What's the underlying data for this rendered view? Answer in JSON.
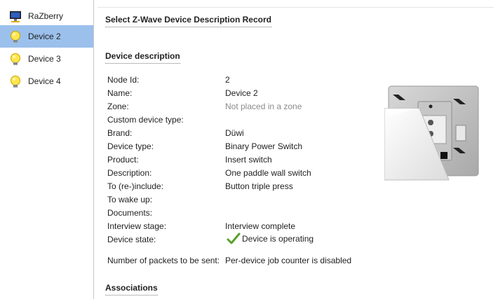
{
  "sidebar": {
    "items": [
      {
        "label": "RaZberry",
        "icon": "computer-icon",
        "active": false
      },
      {
        "label": "Device 2",
        "icon": "lightbulb-icon",
        "active": true
      },
      {
        "label": "Device 3",
        "icon": "lightbulb-icon",
        "active": false
      },
      {
        "label": "Device 4",
        "icon": "lightbulb-icon",
        "active": false
      }
    ]
  },
  "main": {
    "title": "Select Z-Wave Device Description Record",
    "section_description": "Device description",
    "section_associations": "Associations",
    "fields": [
      {
        "label": "Node Id:",
        "value": "2"
      },
      {
        "label": "Name:",
        "value": "Device 2"
      },
      {
        "label": "Zone:",
        "value": "Not placed in a zone"
      },
      {
        "label": "Custom device type:",
        "value": ""
      },
      {
        "label": "Brand:",
        "value": "Düwi"
      },
      {
        "label": "Device type:",
        "value": "Binary Power Switch"
      },
      {
        "label": "Product:",
        "value": "Insert switch"
      },
      {
        "label": "Description:",
        "value": "One paddle wall switch"
      },
      {
        "label": "To (re-)include:",
        "value": "Button triple press"
      },
      {
        "label": "To wake up:",
        "value": ""
      },
      {
        "label": "Documents:",
        "value": ""
      },
      {
        "label": "Interview stage:",
        "value": "Interview complete"
      },
      {
        "label": "Device state:",
        "value": "Device is operating"
      },
      {
        "label": "Number of packets to be sent:",
        "value": "Per-device job counter is disabled"
      }
    ]
  },
  "colors": {
    "active_bg": "#9bc0ec",
    "muted_text": "#8a8a8a",
    "check_green": "#5aa02c"
  }
}
